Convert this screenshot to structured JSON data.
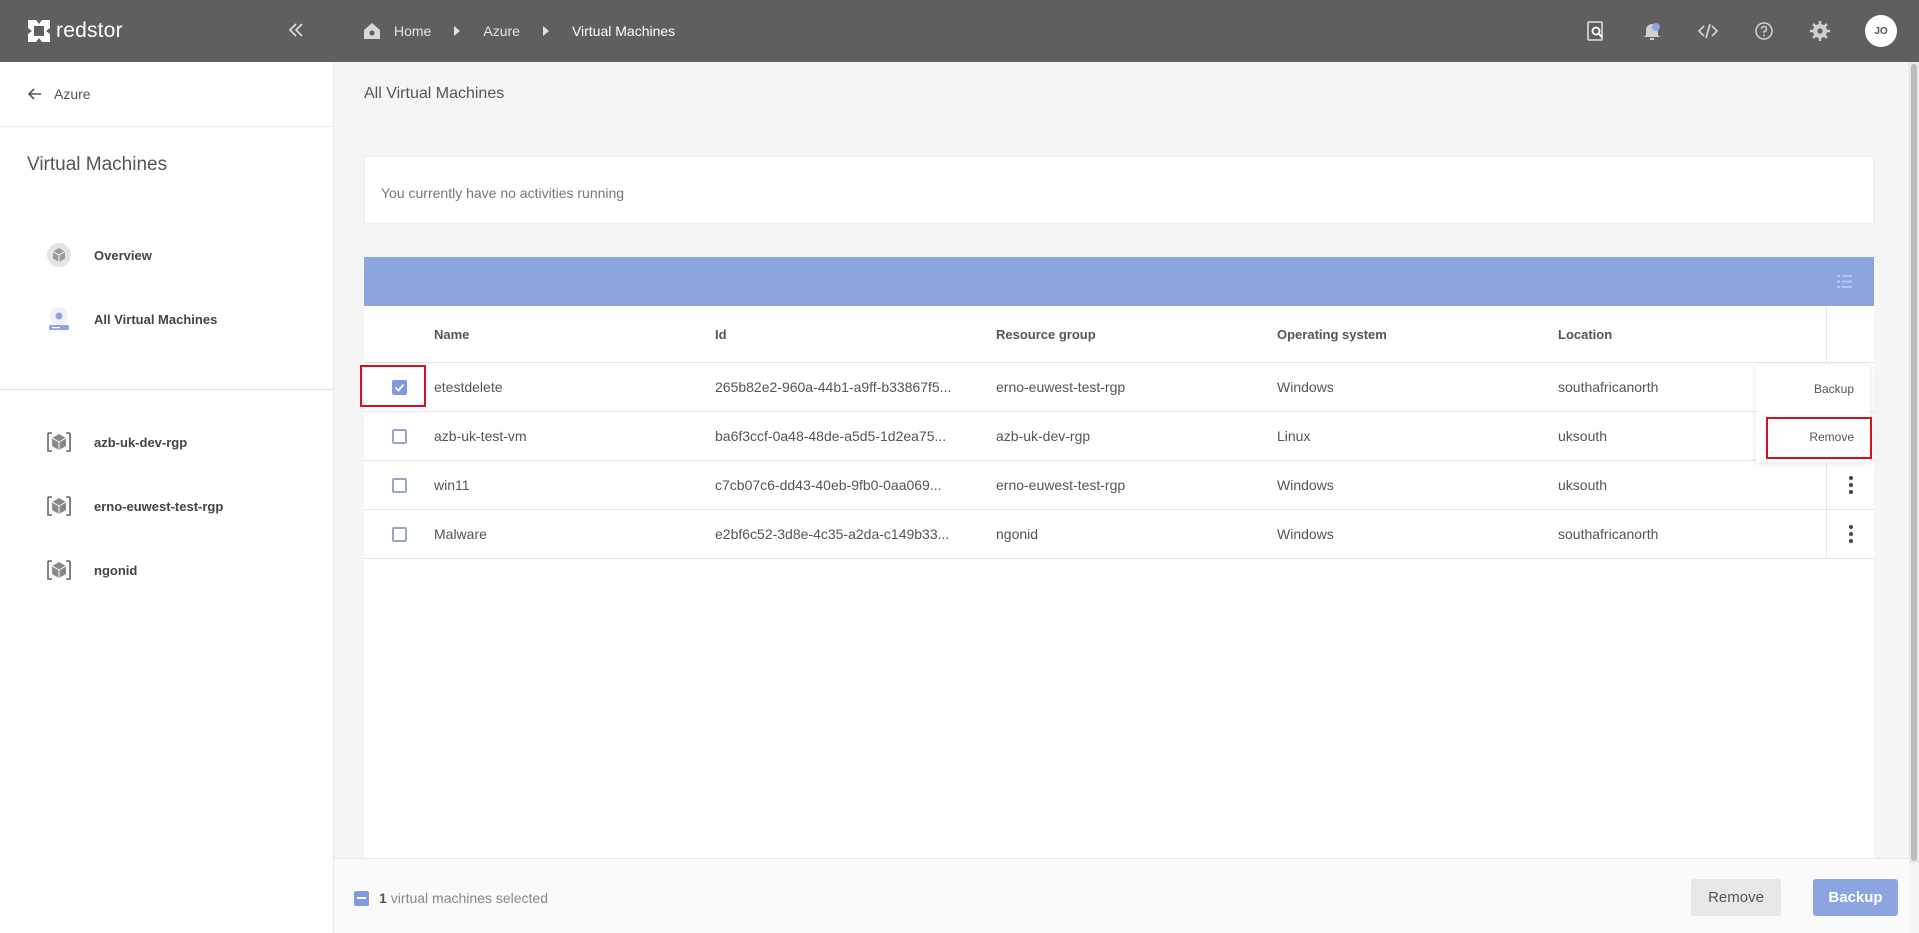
{
  "app": {
    "name": "redstor"
  },
  "topbar": {
    "breadcrumbs": [
      "Home",
      "Azure",
      "Virtual Machines"
    ],
    "avatar_initials": "JO",
    "icons": [
      "search-icon",
      "notifications-icon",
      "code-icon",
      "help-icon",
      "settings-icon"
    ]
  },
  "sidebar": {
    "back_label": "Azure",
    "title": "Virtual Machines",
    "nav": [
      {
        "label": "Overview",
        "icon": "overview-icon"
      },
      {
        "label": "All Virtual Machines",
        "icon": "virtual-machines-icon"
      }
    ],
    "groups": [
      {
        "label": "azb-uk-dev-rgp",
        "icon": "resource-group-icon"
      },
      {
        "label": "erno-euwest-test-rgp",
        "icon": "resource-group-icon"
      },
      {
        "label": "ngonid",
        "icon": "resource-group-icon"
      }
    ]
  },
  "main": {
    "title": "All Virtual Machines",
    "activity_message": "You currently have no activities running",
    "table": {
      "columns": [
        "Name",
        "Id",
        "Resource group",
        "Operating system",
        "Location"
      ],
      "rows": [
        {
          "name": "etestdelete",
          "id": "265b82e2-960a-44b1-a9ff-b33867f5...",
          "resource_group": "erno-euwest-test-rgp",
          "os": "Windows",
          "location": "southafricanorth",
          "checked": true
        },
        {
          "name": "azb-uk-test-vm",
          "id": "ba6f3ccf-0a48-48de-a5d5-1d2ea75...",
          "resource_group": "azb-uk-dev-rgp",
          "os": "Linux",
          "location": "uksouth",
          "checked": false
        },
        {
          "name": "win11",
          "id": "c7cb07c6-dd43-40eb-9fb0-0aa069...",
          "resource_group": "erno-euwest-test-rgp",
          "os": "Windows",
          "location": "uksouth",
          "checked": false
        },
        {
          "name": "Malware",
          "id": "e2bf6c52-3d8e-4c35-a2da-c149b33...",
          "resource_group": "ngonid",
          "os": "Windows",
          "location": "southafricanorth",
          "checked": false
        }
      ]
    },
    "row_menu": {
      "backup": "Backup",
      "remove": "Remove"
    }
  },
  "footer": {
    "selected_count": "1",
    "selected_text": "virtual machines selected",
    "remove_label": "Remove",
    "backup_label": "Backup"
  },
  "colors": {
    "topbar": "#5f5f5f",
    "accent": "#8ca4e0",
    "highlight": "#d8101e"
  }
}
